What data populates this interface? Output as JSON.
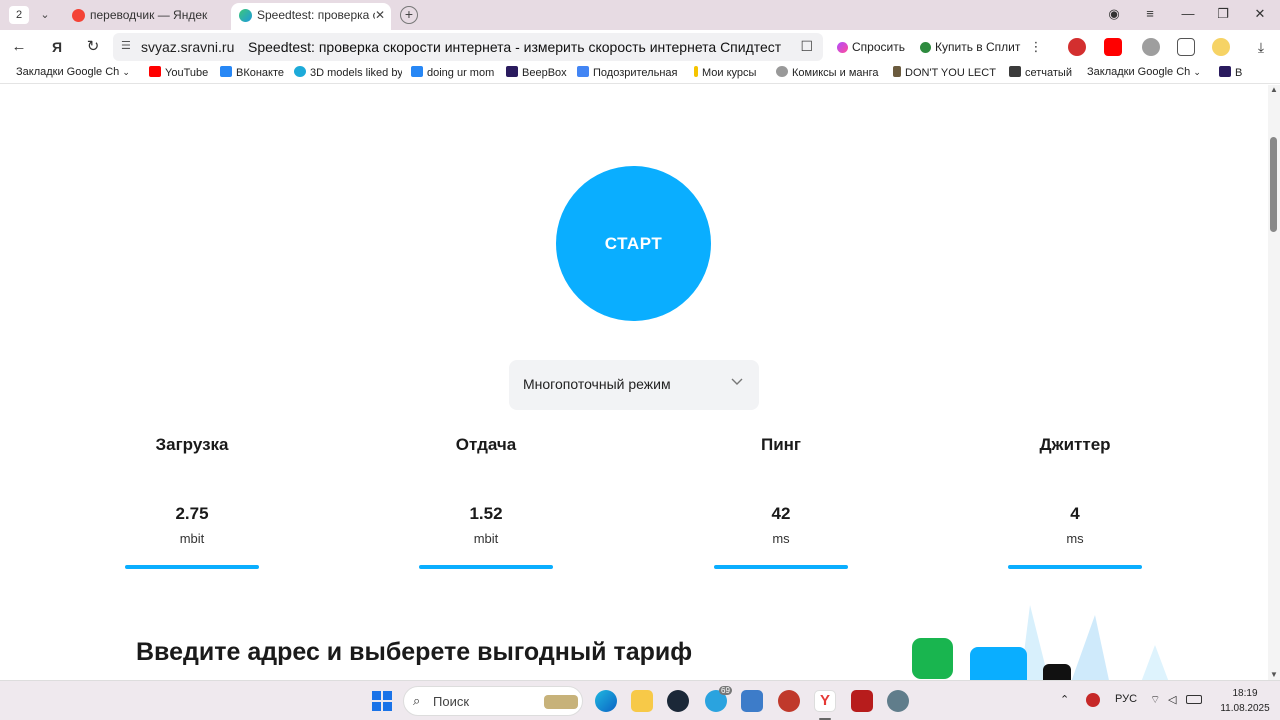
{
  "browser": {
    "tab_count": "2",
    "tabs": [
      {
        "title": "переводчик — Яндекс: на",
        "favicon_color": "#f44336"
      },
      {
        "title": "Speedtest: проверка ск",
        "favicon_color": "#3cc77a"
      }
    ],
    "address": {
      "domain": "svyaz.sravni.ru",
      "page_title": "Speedtest: проверка скорости интернета - измерить скорость интернета Спидтест"
    },
    "toolbar": {
      "ask_label": "Спросить",
      "split_label": "Купить в Сплит"
    }
  },
  "bookmarks": [
    {
      "label": "Закладки Google Ch",
      "icon_color": "transparent"
    },
    {
      "label": "YouTube",
      "icon_color": "#ff0000"
    },
    {
      "label": "ВКонакте",
      "icon_color": "#2787f5"
    },
    {
      "label": "3D models liked by",
      "icon_color": "#1caad9"
    },
    {
      "label": "doing ur mom",
      "icon_color": "#2787f5"
    },
    {
      "label": "BeepBox",
      "icon_color": "#2a1b5e"
    },
    {
      "label": "Подозрительная",
      "icon_color": "#4285f4"
    },
    {
      "label": "Мои курсы",
      "icon_color": "#f5c400"
    },
    {
      "label": "Комиксы и манга",
      "icon_color": "#999999"
    },
    {
      "label": "DON'T YOU LECT",
      "icon_color": "#6b5b3e"
    },
    {
      "label": "сетчатый",
      "icon_color": "#3b3b3b"
    },
    {
      "label": "Закладки Google Ch",
      "icon_color": "transparent"
    },
    {
      "label": "B",
      "icon_color": "#2a1b5e"
    }
  ],
  "speedtest": {
    "start_label": "СТАРТ",
    "mode": "Многопоточный режим",
    "metrics": [
      {
        "label": "Загрузка",
        "value": "2.75",
        "unit": "mbit"
      },
      {
        "label": "Отдача",
        "value": "1.52",
        "unit": "mbit"
      },
      {
        "label": "Пинг",
        "value": "42",
        "unit": "ms"
      },
      {
        "label": "Джиттер",
        "value": "4",
        "unit": "ms"
      }
    ],
    "accent_color": "#0aaeff"
  },
  "promo": {
    "title": "Введите адрес и выберете выгодный тариф"
  },
  "taskbar": {
    "search_placeholder": "Поиск",
    "language": "РУС",
    "time": "18:19",
    "date": "11.08.2025",
    "telegram_badge": "69"
  }
}
